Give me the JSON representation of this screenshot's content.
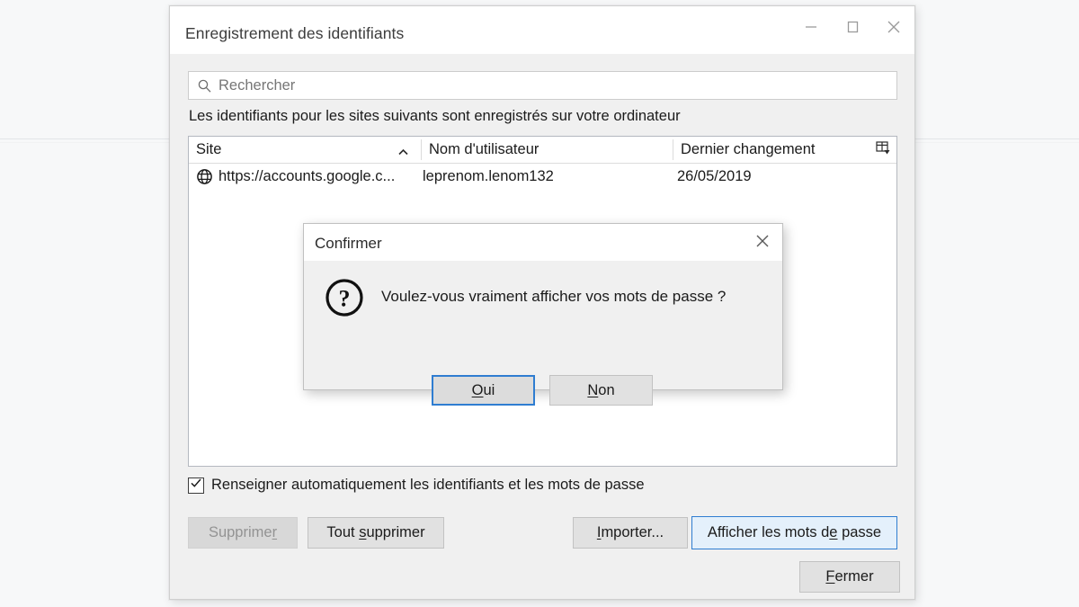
{
  "window": {
    "title": "Enregistrement des identifiants",
    "titlebar_buttons": [
      {
        "name": "minimize-button",
        "glyph": "minimize-icon"
      },
      {
        "name": "maximize-button",
        "glyph": "maximize-icon"
      },
      {
        "name": "close-button",
        "glyph": "close-icon"
      }
    ]
  },
  "search": {
    "placeholder": "Rechercher",
    "value": "",
    "icon": "search-icon"
  },
  "list": {
    "description": "Les identifiants pour les sites suivants sont enregistrés sur votre ordinateur",
    "columns": [
      {
        "label": "Site",
        "sorted": "asc",
        "sort_icon": "chevron-up-icon"
      },
      {
        "label": "Nom d'utilisateur"
      },
      {
        "label": "Dernier changement"
      }
    ],
    "column_picker_icon": "column-chooser-icon",
    "rows": [
      {
        "icon": "globe-icon",
        "site": "https://accounts.google.c...",
        "username": "leprenom.lenom132",
        "last_change": "26/05/2019"
      }
    ]
  },
  "autofill": {
    "label": "Renseigner automatiquement les identifiants et les mots de passe",
    "checked": true,
    "check_icon": "checkmark-icon"
  },
  "actions": {
    "delete": {
      "label": "Supprimer",
      "accel_index": 8,
      "disabled": true
    },
    "delete_all": {
      "label": "Tout supprimer",
      "accel_index": 5,
      "disabled": false
    },
    "import": {
      "label": "Importer...",
      "accel_index": 0,
      "disabled": false
    },
    "show_passwords": {
      "label": "Afficher les mots de passe",
      "accel_index": 19,
      "disabled": false
    },
    "close": {
      "label": "Fermer",
      "accel_index": 0,
      "disabled": false
    }
  },
  "confirm_dialog": {
    "title": "Confirmer",
    "close_icon": "close-icon",
    "icon": "question-mark-icon",
    "message": "Voulez-vous vraiment afficher vos mots de passe ?",
    "yes": {
      "label": "Oui",
      "accel_index": 0,
      "default": true
    },
    "no": {
      "label": "Non",
      "accel_index": 0,
      "default": false
    }
  },
  "colors": {
    "accent": "#2f7dd1",
    "window_bg": "#f0f0f0",
    "titlebar_bg": "#ffffff",
    "page_bg": "#f7f8f9",
    "button_bg": "#e1e1e1",
    "accent_button_bg": "#e4f0fb",
    "text": "#1b1b1b",
    "disabled_text": "#939393"
  }
}
